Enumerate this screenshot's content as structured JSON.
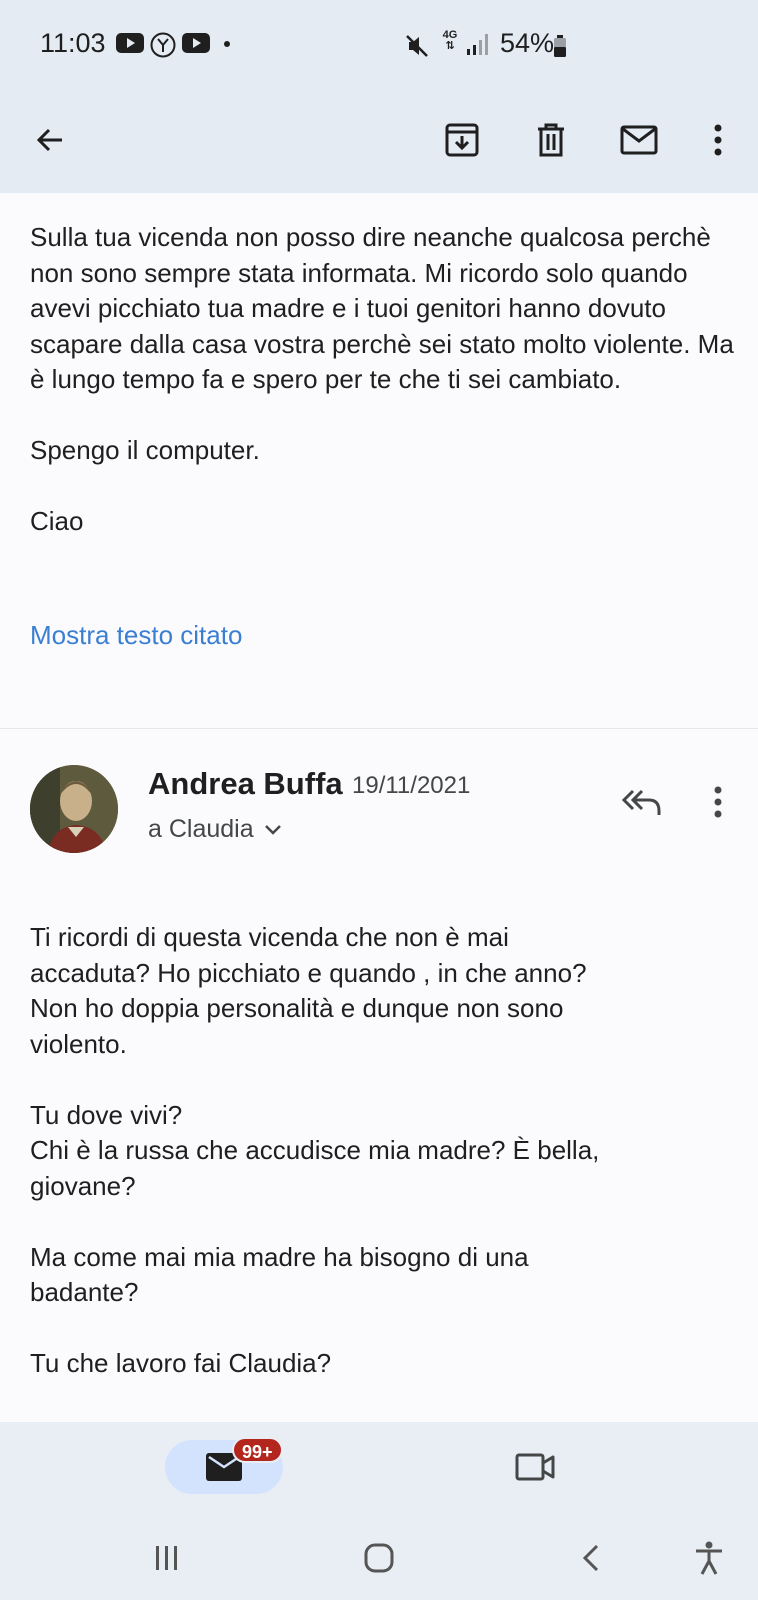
{
  "status_bar": {
    "time": "11:03",
    "network": "4G",
    "battery": "54%",
    "icons": [
      "youtube-icon",
      "yahoo-icon",
      "youtube-icon",
      "notification-dot",
      "mute-icon",
      "signal-icon",
      "battery-icon"
    ]
  },
  "app_bar": {
    "icons": [
      "back-arrow-icon",
      "archive-icon",
      "delete-icon",
      "mark-unread-icon",
      "more-vert-icon"
    ]
  },
  "thread": {
    "message1": {
      "paragraphs": [
        "Sulla tua vicenda non posso dire neanche qualcosa perchè non sono sempre stata informata. Mi ricordo solo quando avevi picchiato tua madre e i tuoi genitori hanno dovuto scapare dalla casa vostra perchè sei stato molto violente. Ma è lungo tempo fa e spero per te che ti sei cambiato.",
        "Spengo il computer.",
        "Ciao"
      ],
      "show_quoted": "Mostra testo citato"
    },
    "message2": {
      "sender": "Andrea Buffa",
      "date": "19/11/2021",
      "recipient": "a Claudia",
      "lines": [
        "Ti ricordi di questa vicenda che non è mai",
        "accaduta? Ho picchiato e quando , in che anno?",
        "Non ho doppia personalità e dunque non sono",
        "violento.",
        "",
        "Tu dove vivi?",
        "Chi è la russa che accudisce mia madre? È bella,",
        "giovane?",
        "",
        "Ma come mai mia madre ha bisogno di una",
        "badante?",
        "",
        "Tu che lavoro fai Claudia?"
      ]
    }
  },
  "bottom_nav": {
    "mail_badge": "99+",
    "items": [
      "mail-icon",
      "meet-video-icon"
    ]
  },
  "colors": {
    "header_bg": "#e4ebf3",
    "body_bg": "#fbfbfe",
    "link": "#3b7fd1",
    "badge": "#b3261e",
    "nav_pill": "#d3e3fd"
  }
}
